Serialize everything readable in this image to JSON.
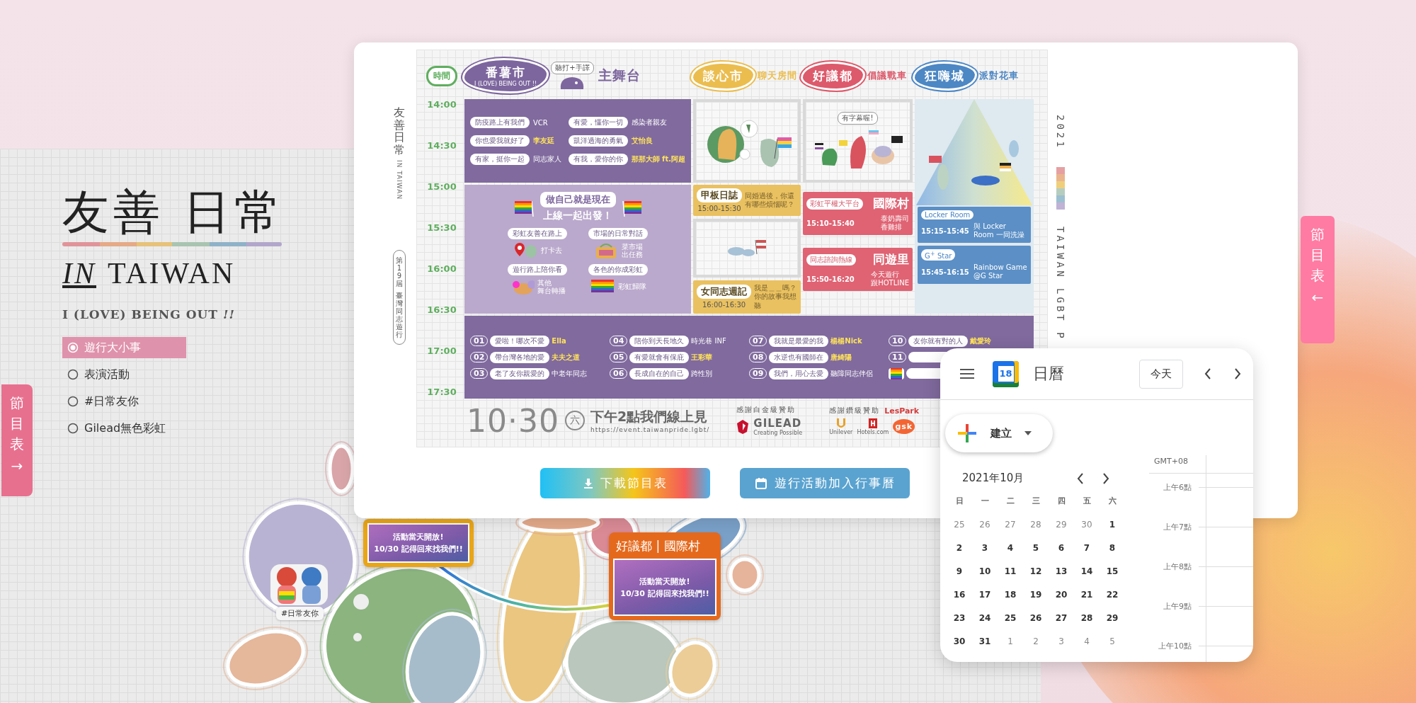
{
  "left_panel": {
    "title": "友善 日常",
    "subtitle_prefix": "IN",
    "subtitle": "TAIWAN",
    "tagline": "I (LOVE) BEING OUT *!!*",
    "filters": [
      {
        "label": "遊行大小事",
        "selected": true
      },
      {
        "label": "表演活動",
        "selected": false
      },
      {
        "label": "#日常友你",
        "selected": false
      },
      {
        "label": "Gilead無色彩虹",
        "selected": false
      }
    ],
    "side_tab": {
      "label": "節目表",
      "arrow": "→"
    }
  },
  "map": {
    "sticker_label": "#日常友你",
    "cards": [
      {
        "color": "#e9a516",
        "banner": [
          "活動當天開放!",
          "10/30 記得回來找我們!!"
        ]
      },
      {
        "color": "#e5691d",
        "title": "好議都 | 國際村",
        "banner": [
          "活動當天開放!",
          "10/30 記得回來找我們!!"
        ]
      }
    ]
  },
  "schedule_modal": {
    "poster": {
      "side_title": "友善日常",
      "side_subtitle": "IN TAIWAN",
      "edition": [
        "第19屆",
        "臺灣同志遊行"
      ],
      "year": "2021",
      "side_caption": "TAIWAN LGBT P",
      "time_label": "時間",
      "times": [
        "14:00",
        "14:30",
        "15:00",
        "15:30",
        "16:00",
        "16:30",
        "17:00",
        "17:30"
      ],
      "stages": [
        {
          "name": "番薯市",
          "tagline": "I (LOVE) BEING OUT !!",
          "bubble": "聽打+手譯",
          "venue": "主舞台",
          "color": "#7d669e"
        },
        {
          "name": "談心市",
          "venue": "聊天房間",
          "color": "#ebbd4f"
        },
        {
          "name": "好議都",
          "venue": "倡議戰車",
          "color": "#dc5a6b"
        },
        {
          "name": "狂嗨城",
          "venue": "派對花車",
          "color": "#4d87c4"
        }
      ],
      "main_stage": [
        {
          "title": "防疫路上有我們",
          "performer": "VCR",
          "highlight": false
        },
        {
          "title": "你也愛我就好了",
          "performer": "李友廷",
          "highlight": true
        },
        {
          "title": "有家，挺你一起",
          "performer": "同志家人",
          "highlight": false
        },
        {
          "title": "有愛，懂你一切",
          "performer": "感染者親友",
          "highlight": false
        },
        {
          "title": "凱洋過海的勇氣",
          "performer": "艾怡良",
          "highlight": true
        },
        {
          "title": "有我，愛你的你",
          "performer": "那那大師 ft.阿超",
          "highlight": true
        }
      ],
      "online": {
        "heading": [
          "做自己就是現在",
          "上線一起出發！"
        ],
        "activities": [
          {
            "kind": "checkin",
            "title": "彩虹友善在路上",
            "caption": "打卡去"
          },
          {
            "kind": "market",
            "title": "市場的日常對話",
            "caption": [
              "菜市場",
              "出任務"
            ]
          },
          {
            "kind": "broadcast",
            "title": "遊行路上陪你看",
            "caption": [
              "其他",
              "舞台轉播"
            ]
          },
          {
            "kind": "rainbow",
            "title": "各色的你成彩虹",
            "caption": "彩虹歸隊"
          }
        ]
      },
      "talk_sessions": [
        {
          "title": "甲板日誌",
          "time": "15:00-15:30",
          "note": "同婚過後，你還有哪些煩惱呢？"
        },
        {
          "title": "女同志週記",
          "time": "16:00-16:30",
          "note": "我是＿＿嗎？你的故事我想聽"
        }
      ],
      "advocacy": {
        "bubble": "有字幕喔!",
        "sessions": [
          {
            "host": "彩虹平權大平台",
            "title": "國際村",
            "time": "15:10-15:40",
            "note": [
              "泰奶壽司",
              "香雞排"
            ]
          },
          {
            "host": "同志諮詢熱線",
            "title": "同遊里",
            "time": "15:50-16:20",
            "note": [
              "今天遊行",
              "跟HOTLINE"
            ]
          }
        ]
      },
      "party_sessions": [
        {
          "host": "Locker Room",
          "time": "15:15-15:45",
          "note": "與 Locker Room 一同洗澡"
        },
        {
          "host": "G$^{+}$ Star",
          "time": "15:45-16:15",
          "note": "Rainbow Game @G Star"
        }
      ],
      "lineup": [
        {
          "kind": "numbered",
          "number": "01",
          "title": "愛啦！哪次不愛",
          "performer": "Ella",
          "highlight": true
        },
        {
          "kind": "numbered",
          "number": "02",
          "title": "帶台灣各地的愛",
          "performer": "夫夫之道",
          "highlight": true
        },
        {
          "kind": "numbered",
          "number": "03",
          "title": "老了友你親愛的",
          "performer": "中老年同志",
          "highlight": false
        },
        {
          "kind": "numbered",
          "number": "04",
          "title": "陪你到天長地久",
          "performer": "時光巷 INF",
          "highlight": false
        },
        {
          "kind": "numbered",
          "number": "05",
          "title": "有愛就會有保庇",
          "performer": "王彩華",
          "highlight": true
        },
        {
          "kind": "numbered",
          "number": "06",
          "title": "長成自在的自己",
          "performer": "跨性別",
          "highlight": false
        },
        {
          "kind": "numbered",
          "number": "07",
          "title": "我就是最愛的我",
          "performer": "楊楊Nick",
          "highlight": true
        },
        {
          "kind": "numbered",
          "number": "08",
          "title": "水逆也有國師在",
          "performer": "唐綺陽",
          "highlight": true
        },
        {
          "kind": "numbered",
          "number": "09",
          "title": "我們，用心去愛",
          "performer": "聽障同志伴侶",
          "highlight": false
        },
        {
          "kind": "numbered",
          "number": "10",
          "title": "友你就有對的人",
          "performer": "戴愛玲",
          "highlight": true
        },
        {
          "kind": "numbered",
          "number": "11"
        },
        {
          "kind": "flag"
        }
      ],
      "footer": {
        "date": "10·30",
        "weekday": "六",
        "slogan": "下午2點我們線上見",
        "url": "https://event.taiwanpride.lgbt/",
        "sponsors": [
          {
            "label": "感謝白金級贊助",
            "logos": [
              {
                "kind": "gilead",
                "name": "GILEAD",
                "tagline": "Creating Possible"
              }
            ]
          },
          {
            "label": "感謝鑽級贊助",
            "logos": [
              {
                "kind": "lespark",
                "name": "LesPark"
              },
              {
                "kind": "unilever",
                "name": "Unilever"
              },
              {
                "kind": "hotels",
                "name": "Hotels.com"
              },
              {
                "kind": "gsk",
                "name": "gsk"
              }
            ]
          }
        ]
      }
    },
    "buttons": [
      {
        "kind": "download",
        "label": "下載節目表"
      },
      {
        "kind": "calendar",
        "label": "遊行活動加入行事曆"
      }
    ]
  },
  "right_tab": {
    "label": "節目表",
    "arrow": "←"
  },
  "calendar": {
    "title": "日曆",
    "logo_day": "18",
    "today_button": "今天",
    "create_button": "建立",
    "month": "2021年10月",
    "weekdays": [
      "日",
      "一",
      "二",
      "三",
      "四",
      "五",
      "六"
    ],
    "weeks": [
      [
        {
          "day": "25",
          "outside": true
        },
        {
          "day": "26",
          "outside": true
        },
        {
          "day": "27",
          "outside": true
        },
        {
          "day": "28",
          "outside": true
        },
        {
          "day": "29",
          "outside": true
        },
        {
          "day": "30",
          "outside": true
        },
        {
          "day": "1",
          "outside": false
        }
      ],
      [
        {
          "day": "2",
          "outside": false
        },
        {
          "day": "3",
          "outside": false
        },
        {
          "day": "4",
          "outside": false
        },
        {
          "day": "5",
          "outside": false
        },
        {
          "day": "6",
          "outside": false
        },
        {
          "day": "7",
          "outside": false
        },
        {
          "day": "8",
          "outside": false
        }
      ],
      [
        {
          "day": "9",
          "outside": false
        },
        {
          "day": "10",
          "outside": false
        },
        {
          "day": "11",
          "outside": false
        },
        {
          "day": "12",
          "outside": false
        },
        {
          "day": "13",
          "outside": false
        },
        {
          "day": "14",
          "outside": false
        },
        {
          "day": "15",
          "outside": false
        }
      ],
      [
        {
          "day": "16",
          "outside": false
        },
        {
          "day": "17",
          "outside": false
        },
        {
          "day": "18",
          "outside": false
        },
        {
          "day": "19",
          "outside": false
        },
        {
          "day": "20",
          "outside": false
        },
        {
          "day": "21",
          "outside": false
        },
        {
          "day": "22",
          "outside": false
        }
      ],
      [
        {
          "day": "23",
          "outside": false
        },
        {
          "day": "24",
          "outside": false
        },
        {
          "day": "25",
          "outside": false
        },
        {
          "day": "26",
          "outside": false
        },
        {
          "day": "27",
          "outside": false
        },
        {
          "day": "28",
          "outside": false
        },
        {
          "day": "29",
          "outside": false
        }
      ],
      [
        {
          "day": "30",
          "outside": false
        },
        {
          "day": "31",
          "outside": false
        },
        {
          "day": "1",
          "outside": true
        },
        {
          "day": "2",
          "outside": true
        },
        {
          "day": "3",
          "outside": true
        },
        {
          "day": "4",
          "outside": true
        },
        {
          "day": "5",
          "outside": true
        }
      ]
    ],
    "timezone": "GMT+08",
    "hours": [
      "上午6點",
      "上午7點",
      "上午8點",
      "上午9點",
      "上午10點"
    ]
  }
}
